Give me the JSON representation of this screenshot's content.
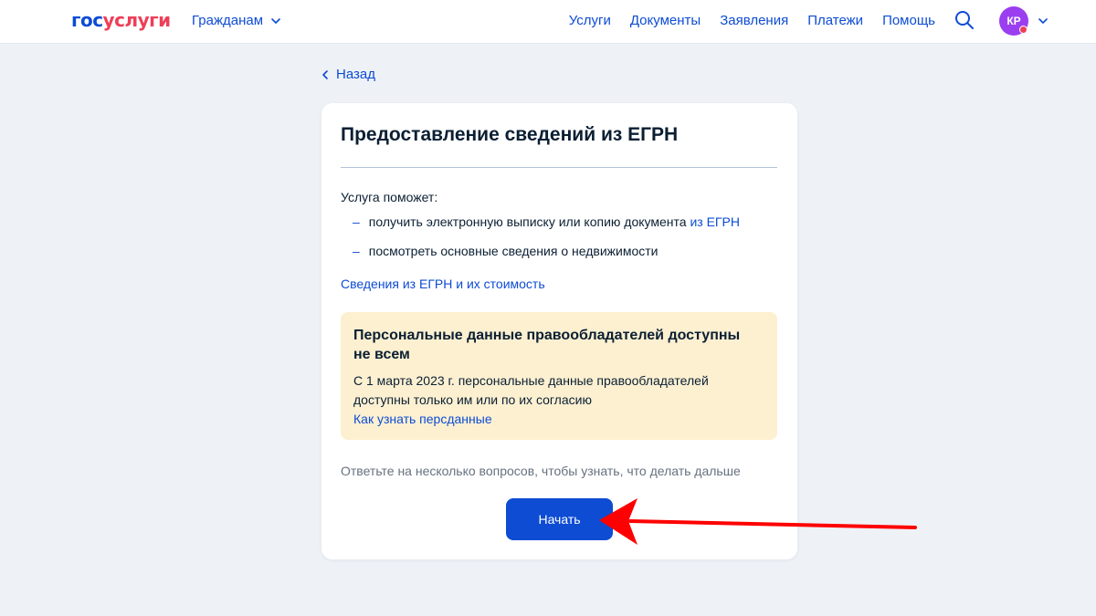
{
  "header": {
    "logo_part1": "гос",
    "logo_part2": "услуги",
    "audience": "Гражданам",
    "nav": [
      "Услуги",
      "Документы",
      "Заявления",
      "Платежи",
      "Помощь"
    ],
    "avatar_initials": "КР"
  },
  "back_label": "Назад",
  "card": {
    "title": "Предоставление сведений из ЕГРН",
    "intro": "Услуга поможет:",
    "list": {
      "item1_text": "получить электронную выписку или копию документа ",
      "item1_link": "из ЕГРН",
      "item2_text": "посмотреть основные сведения о недвижимости",
      "dash": "–"
    },
    "info_link": "Сведения из ЕГРН и их стоимость",
    "notice": {
      "title": "Персональные данные правообладателей доступны не всем",
      "text": "С 1 марта 2023 г. персональные данные правообладателей доступны только им или по их согласию",
      "link": "Как узнать персданные"
    },
    "hint": "Ответьте на несколько вопросов, чтобы узнать, что делать дальше",
    "start_button": "Начать"
  },
  "colors": {
    "brand_blue": "#0d4cd3",
    "brand_red": "#ee3f58",
    "notice_bg": "#fcf0d1",
    "avatar_bg": "#9b3ef0",
    "arrow": "#ff0000"
  },
  "icons": {
    "search": "search-icon",
    "chevron": "chevron-down-icon",
    "back": "chevron-left-icon",
    "annotation_arrow": "red-arrow-icon"
  }
}
